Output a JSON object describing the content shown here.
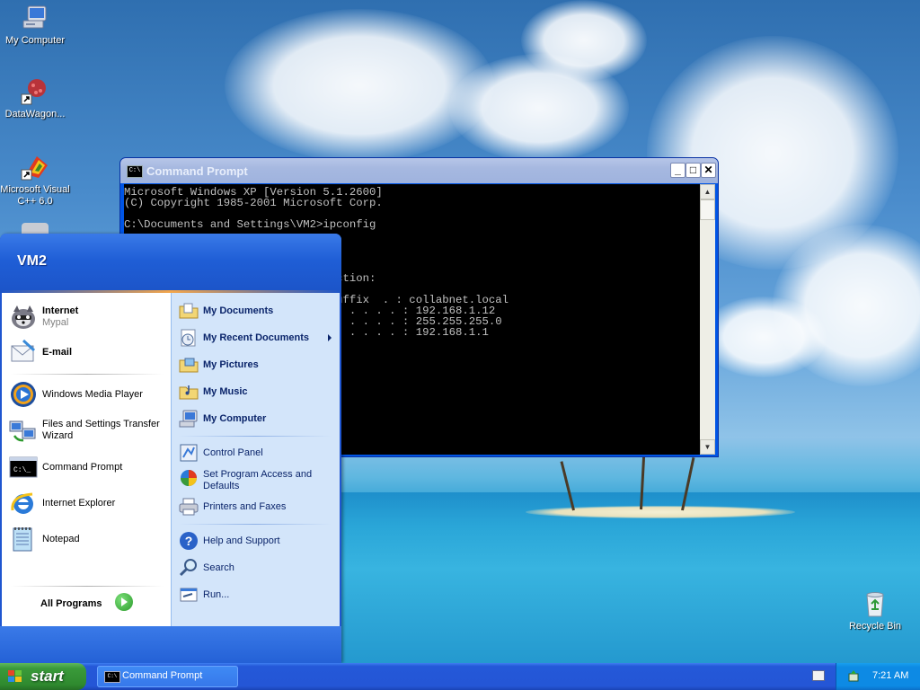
{
  "desktop_icons": [
    {
      "label": "My Computer",
      "icon": "my-computer-icon"
    },
    {
      "label": "DataWagon...",
      "icon": "datawagon-shortcut-icon"
    },
    {
      "label": "Microsoft Visual C++ 6.0",
      "icon": "visual-cpp-shortcut-icon"
    },
    {
      "label": "Recycle Bin",
      "icon": "recycle-bin-icon"
    }
  ],
  "cmd_window": {
    "title": "Command Prompt",
    "minimize": "_",
    "maximize": "□",
    "close": "✕",
    "console": [
      "Microsoft Windows XP [Version 5.1.2600]",
      "(C) Copyright 1985-2001 Microsoft Corp.",
      "",
      "C:\\Documents and Settings\\VM2>ipconfig",
      "",
      "",
      "",
      "",
      "                             nnection:",
      "",
      "                             S Suffix  . : collabnet.local",
      "                              . . . . . . : 192.168.1.12",
      "                              . . . . . . : 255.255.255.0",
      "                              . . . . . . : 192.168.1.1"
    ]
  },
  "start_menu": {
    "username": "VM2",
    "left_pinned": [
      {
        "label": "Internet",
        "sublabel": "Mypal",
        "icon": "mypal-browser-icon"
      },
      {
        "label": "E-mail",
        "icon": "email-icon"
      }
    ],
    "left_recent": [
      {
        "label": "Windows Media Player",
        "icon": "media-player-icon"
      },
      {
        "label": "Files and Settings Transfer Wizard",
        "line1": "Files and Settings Transfer",
        "line2": "Wizard",
        "icon": "transfer-wizard-icon"
      },
      {
        "label": "Command Prompt",
        "icon": "command-prompt-icon"
      },
      {
        "label": "Internet Explorer",
        "icon": "internet-explorer-icon"
      },
      {
        "label": "Notepad",
        "icon": "notepad-icon"
      }
    ],
    "all_programs": "All Programs",
    "right_items": [
      {
        "label": "My Documents",
        "icon": "folder-documents-icon"
      },
      {
        "label": "My Recent Documents",
        "icon": "recent-documents-icon"
      },
      {
        "label": "My Pictures",
        "icon": "folder-pictures-icon"
      },
      {
        "label": "My Music",
        "icon": "folder-music-icon"
      },
      {
        "label": "My Computer",
        "icon": "computer-icon"
      },
      {
        "label": "Control Panel",
        "icon": "control-panel-icon"
      },
      {
        "label": "Set Program Access and Defaults",
        "line1": "Set Program Access and",
        "line2": "Defaults",
        "icon": "program-access-icon"
      },
      {
        "label": "Printers and Faxes",
        "icon": "printer-icon"
      },
      {
        "label": "Help and Support",
        "icon": "help-icon"
      },
      {
        "label": "Search",
        "icon": "search-icon"
      },
      {
        "label": "Run...",
        "icon": "run-icon"
      }
    ]
  },
  "taskbar": {
    "start_label": "start",
    "tasks": [
      {
        "label": "Command Prompt",
        "icon": "command-prompt-icon"
      }
    ],
    "clock": "7:21 AM"
  },
  "colors": {
    "xp_blue": "#2458d8",
    "start_green": "#3a9a3a",
    "tray_blue": "#0d8ae4",
    "menu_right_bg": "#d3e5fa"
  }
}
